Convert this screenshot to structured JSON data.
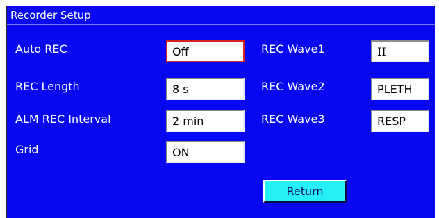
{
  "window": {
    "title": "Recorder Setup"
  },
  "settings_left": [
    {
      "label": "Auto REC",
      "value": "Off",
      "selected": true
    },
    {
      "label": "REC Length",
      "value": "8 s"
    },
    {
      "label": "ALM REC Interval",
      "value": "2 min"
    },
    {
      "label": "Grid",
      "value": "ON"
    }
  ],
  "settings_right": [
    {
      "label": "REC Wave1",
      "value": "II"
    },
    {
      "label": "REC Wave2",
      "value": "PLETH"
    },
    {
      "label": "REC Wave3",
      "value": "RESP"
    }
  ],
  "buttons": {
    "return_label": "Return"
  },
  "colors": {
    "window_background": "#0707F1",
    "return_button": "#26F0F5",
    "selected_border": "#D02020"
  }
}
